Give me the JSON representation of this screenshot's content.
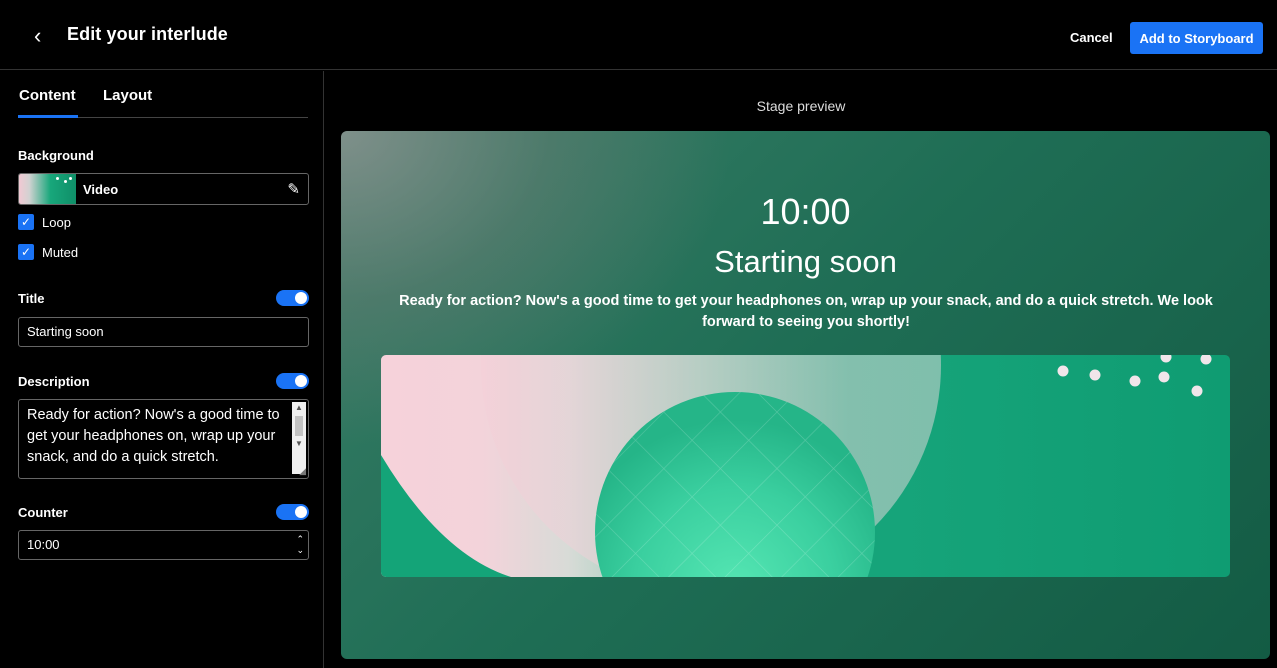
{
  "header": {
    "title": "Edit your interlude",
    "cancel_label": "Cancel",
    "add_label": "Add to Storyboard"
  },
  "tabs": {
    "content": "Content",
    "layout": "Layout",
    "active": "Content"
  },
  "background": {
    "label": "Background",
    "type": "Video",
    "loop_label": "Loop",
    "loop_checked": true,
    "muted_label": "Muted",
    "muted_checked": true
  },
  "title_field": {
    "label": "Title",
    "enabled": true,
    "value": "Starting soon"
  },
  "description_field": {
    "label": "Description",
    "enabled": true,
    "value": "Ready for action? Now's a good time to get your headphones on, wrap up your snack, and do a quick stretch."
  },
  "counter_field": {
    "label": "Counter",
    "enabled": true,
    "value": "10:00"
  },
  "preview": {
    "label": "Stage preview",
    "counter": "10:00",
    "title": "Starting soon",
    "description": "Ready for action? Now's a good time to get your headphones on, wrap up your snack, and do a quick stretch. We look forward to seeing you shortly!"
  },
  "colors": {
    "accent": "#1a73f5",
    "background": "#000000",
    "stage_green": "#1f6e55",
    "video_teal": "#13a47a",
    "video_pink": "#f6d2da"
  },
  "icons": {
    "back": "chevron-left-icon",
    "edit": "pencil-icon",
    "check": "checkmark-icon"
  }
}
